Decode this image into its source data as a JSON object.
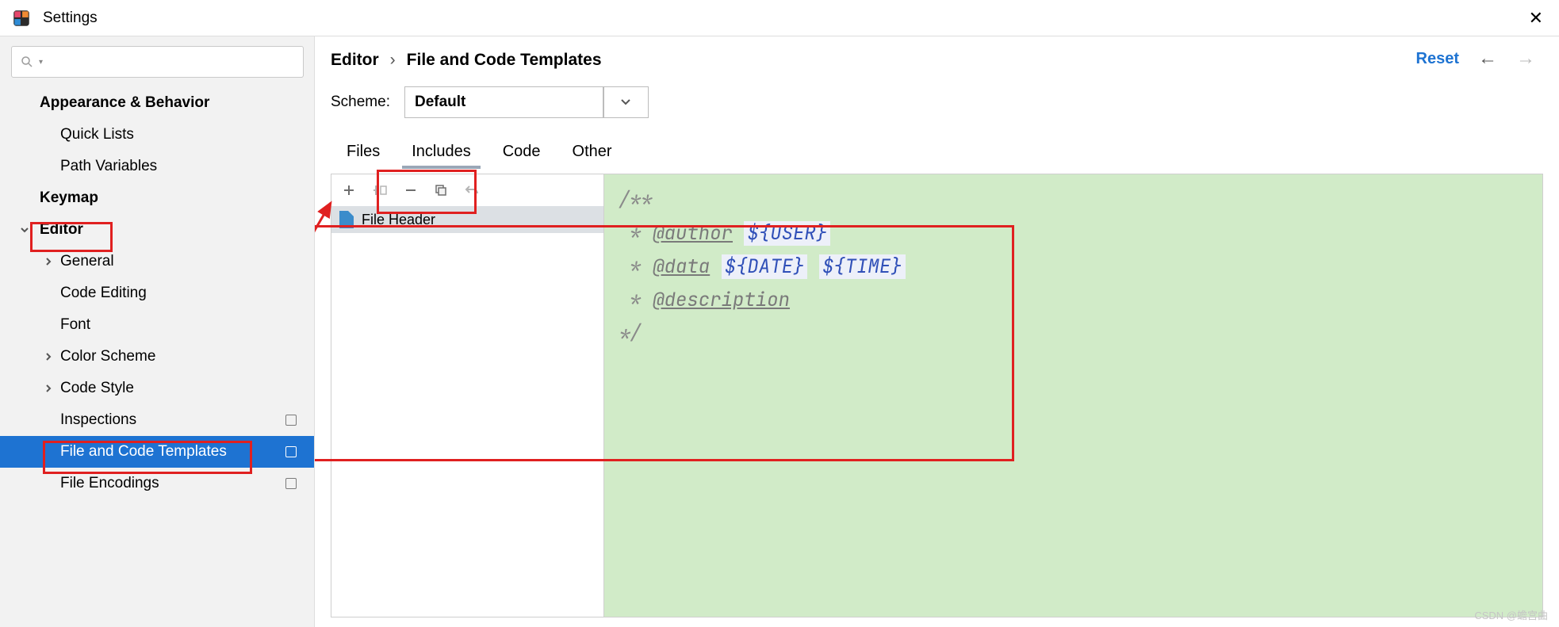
{
  "window": {
    "title": "Settings"
  },
  "search": {
    "placeholder": ""
  },
  "sidebar": {
    "items": [
      {
        "label": "Appearance & Behavior"
      },
      {
        "label": "Quick Lists"
      },
      {
        "label": "Path Variables"
      },
      {
        "label": "Keymap"
      },
      {
        "label": "Editor"
      },
      {
        "label": "General"
      },
      {
        "label": "Code Editing"
      },
      {
        "label": "Font"
      },
      {
        "label": "Color Scheme"
      },
      {
        "label": "Code Style"
      },
      {
        "label": "Inspections"
      },
      {
        "label": "File and Code Templates"
      },
      {
        "label": "File Encodings"
      }
    ]
  },
  "breadcrumb": {
    "a": "Editor",
    "sep": "›",
    "b": "File and Code Templates"
  },
  "actions": {
    "reset": "Reset"
  },
  "scheme": {
    "label": "Scheme:",
    "value": "Default"
  },
  "tabs": [
    {
      "label": "Files"
    },
    {
      "label": "Includes"
    },
    {
      "label": "Code"
    },
    {
      "label": "Other"
    }
  ],
  "template_list": [
    {
      "label": "File Header"
    }
  ],
  "code": {
    "l1": "/**",
    "star": " * ",
    "tag_author": "@author",
    "var_user": "${USER}",
    "tag_data": "@data",
    "var_date": "${DATE}",
    "var_time": "${TIME}",
    "tag_desc": "@description",
    "l_end": "*/"
  },
  "watermark": "CSDN @蟾宫曲"
}
